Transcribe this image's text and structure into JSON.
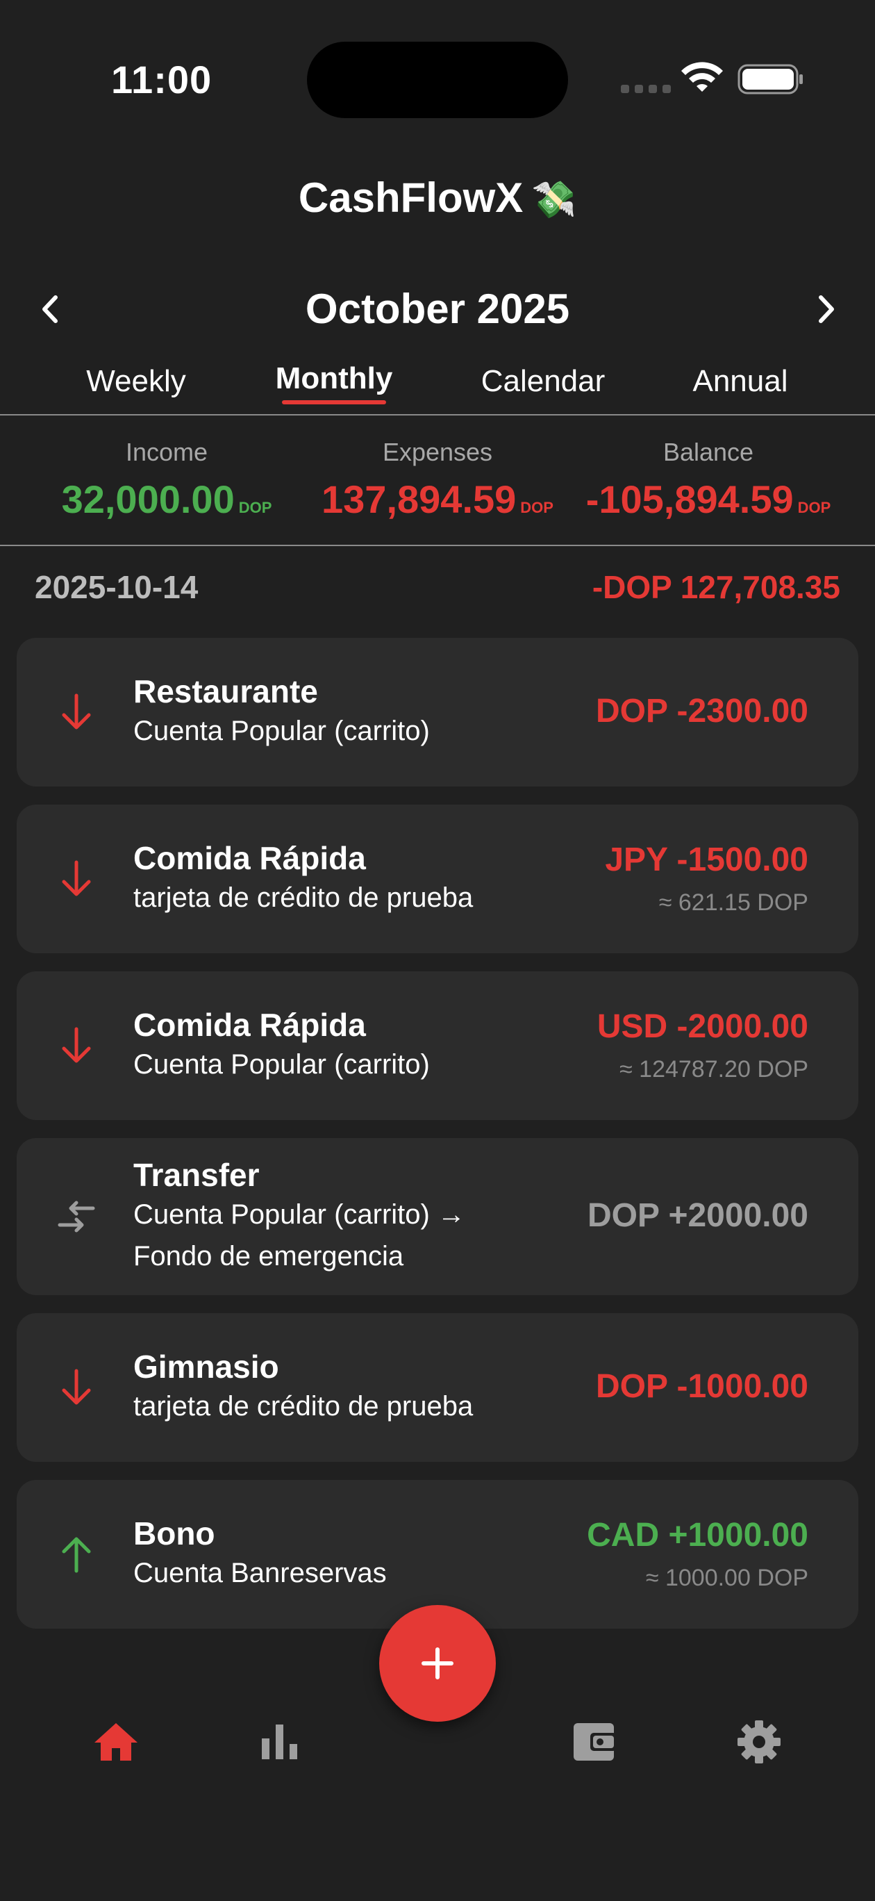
{
  "status": {
    "time": "11:00"
  },
  "app": {
    "title": "CashFlowX",
    "title_icon": "money-with-wings-icon",
    "title_emoji": "💸"
  },
  "nav": {
    "month_label": "October 2025"
  },
  "tabs": [
    {
      "label": "Weekly",
      "active": false
    },
    {
      "label": "Monthly",
      "active": true
    },
    {
      "label": "Calendar",
      "active": false
    },
    {
      "label": "Annual",
      "active": false
    }
  ],
  "summary": {
    "income": {
      "label": "Income",
      "value": "32,000.00",
      "currency": "DOP",
      "color": "#4caf50"
    },
    "expenses": {
      "label": "Expenses",
      "value": "137,894.59",
      "currency": "DOP",
      "color": "#e53935"
    },
    "balance": {
      "label": "Balance",
      "value": "-105,894.59",
      "currency": "DOP",
      "color": "#e53935"
    }
  },
  "day": {
    "date": "2025-10-14",
    "total": "-DOP 127,708.35"
  },
  "transactions": [
    {
      "icon": "arrow-down-icon",
      "title": "Restaurante",
      "subtitle": "Cuenta Popular (carrito)",
      "amount": "DOP -2300.00",
      "approx": "",
      "type": "expense"
    },
    {
      "icon": "arrow-down-icon",
      "title": "Comida Rápida",
      "subtitle": "tarjeta de crédito de prueba",
      "amount": "JPY -1500.00",
      "approx": "≈ 621.15 DOP",
      "type": "expense"
    },
    {
      "icon": "arrow-down-icon",
      "title": "Comida Rápida",
      "subtitle": "Cuenta Popular (carrito)",
      "amount": "USD -2000.00",
      "approx": "≈ 124787.20 DOP",
      "type": "expense"
    },
    {
      "icon": "transfer-arrows-icon",
      "title": "Transfer",
      "subtitle": "Cuenta Popular (carrito) →",
      "subtitle2": "Fondo de emergencia",
      "amount": "DOP +2000.00",
      "approx": "",
      "type": "transfer"
    },
    {
      "icon": "arrow-down-icon",
      "title": "Gimnasio",
      "subtitle": "tarjeta de crédito de prueba",
      "amount": "DOP -1000.00",
      "approx": "",
      "type": "expense"
    },
    {
      "icon": "arrow-up-icon",
      "title": "Bono",
      "subtitle": "Cuenta Banreservas",
      "amount": "CAD +1000.00",
      "approx": "≈ 1000.00 DOP",
      "type": "income"
    }
  ],
  "bottom_nav": [
    {
      "icon": "home-icon",
      "active": true
    },
    {
      "icon": "bar-chart-icon",
      "active": false
    },
    {
      "icon": "wallet-icon",
      "active": false
    },
    {
      "icon": "gear-icon",
      "active": false
    }
  ],
  "colors": {
    "accent": "#e53935",
    "income": "#4caf50",
    "expense": "#e53935",
    "transfer": "#9e9e9e",
    "background": "#202020",
    "card": "#2c2c2c"
  }
}
